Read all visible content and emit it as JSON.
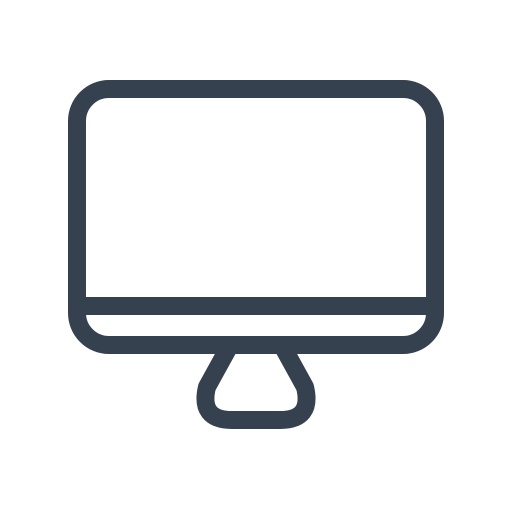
{
  "icon": {
    "name": "desktop-monitor-icon",
    "stroke_color": "#36414f",
    "background_color": "#ffffff"
  }
}
